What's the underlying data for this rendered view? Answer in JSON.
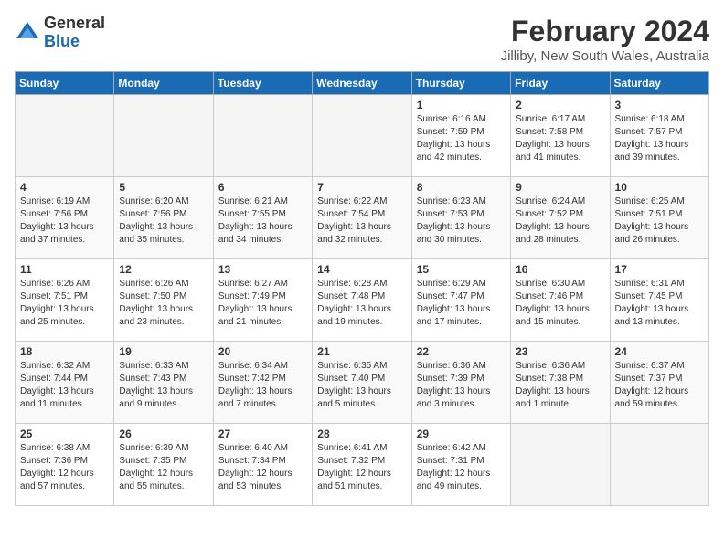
{
  "header": {
    "logo_general": "General",
    "logo_blue": "Blue",
    "month_title": "February 2024",
    "location": "Jilliby, New South Wales, Australia"
  },
  "days_of_week": [
    "Sunday",
    "Monday",
    "Tuesday",
    "Wednesday",
    "Thursday",
    "Friday",
    "Saturday"
  ],
  "weeks": [
    [
      {
        "day": "",
        "info": ""
      },
      {
        "day": "",
        "info": ""
      },
      {
        "day": "",
        "info": ""
      },
      {
        "day": "",
        "info": ""
      },
      {
        "day": "1",
        "info": "Sunrise: 6:16 AM\nSunset: 7:59 PM\nDaylight: 13 hours\nand 42 minutes."
      },
      {
        "day": "2",
        "info": "Sunrise: 6:17 AM\nSunset: 7:58 PM\nDaylight: 13 hours\nand 41 minutes."
      },
      {
        "day": "3",
        "info": "Sunrise: 6:18 AM\nSunset: 7:57 PM\nDaylight: 13 hours\nand 39 minutes."
      }
    ],
    [
      {
        "day": "4",
        "info": "Sunrise: 6:19 AM\nSunset: 7:56 PM\nDaylight: 13 hours\nand 37 minutes."
      },
      {
        "day": "5",
        "info": "Sunrise: 6:20 AM\nSunset: 7:56 PM\nDaylight: 13 hours\nand 35 minutes."
      },
      {
        "day": "6",
        "info": "Sunrise: 6:21 AM\nSunset: 7:55 PM\nDaylight: 13 hours\nand 34 minutes."
      },
      {
        "day": "7",
        "info": "Sunrise: 6:22 AM\nSunset: 7:54 PM\nDaylight: 13 hours\nand 32 minutes."
      },
      {
        "day": "8",
        "info": "Sunrise: 6:23 AM\nSunset: 7:53 PM\nDaylight: 13 hours\nand 30 minutes."
      },
      {
        "day": "9",
        "info": "Sunrise: 6:24 AM\nSunset: 7:52 PM\nDaylight: 13 hours\nand 28 minutes."
      },
      {
        "day": "10",
        "info": "Sunrise: 6:25 AM\nSunset: 7:51 PM\nDaylight: 13 hours\nand 26 minutes."
      }
    ],
    [
      {
        "day": "11",
        "info": "Sunrise: 6:26 AM\nSunset: 7:51 PM\nDaylight: 13 hours\nand 25 minutes."
      },
      {
        "day": "12",
        "info": "Sunrise: 6:26 AM\nSunset: 7:50 PM\nDaylight: 13 hours\nand 23 minutes."
      },
      {
        "day": "13",
        "info": "Sunrise: 6:27 AM\nSunset: 7:49 PM\nDaylight: 13 hours\nand 21 minutes."
      },
      {
        "day": "14",
        "info": "Sunrise: 6:28 AM\nSunset: 7:48 PM\nDaylight: 13 hours\nand 19 minutes."
      },
      {
        "day": "15",
        "info": "Sunrise: 6:29 AM\nSunset: 7:47 PM\nDaylight: 13 hours\nand 17 minutes."
      },
      {
        "day": "16",
        "info": "Sunrise: 6:30 AM\nSunset: 7:46 PM\nDaylight: 13 hours\nand 15 minutes."
      },
      {
        "day": "17",
        "info": "Sunrise: 6:31 AM\nSunset: 7:45 PM\nDaylight: 13 hours\nand 13 minutes."
      }
    ],
    [
      {
        "day": "18",
        "info": "Sunrise: 6:32 AM\nSunset: 7:44 PM\nDaylight: 13 hours\nand 11 minutes."
      },
      {
        "day": "19",
        "info": "Sunrise: 6:33 AM\nSunset: 7:43 PM\nDaylight: 13 hours\nand 9 minutes."
      },
      {
        "day": "20",
        "info": "Sunrise: 6:34 AM\nSunset: 7:42 PM\nDaylight: 13 hours\nand 7 minutes."
      },
      {
        "day": "21",
        "info": "Sunrise: 6:35 AM\nSunset: 7:40 PM\nDaylight: 13 hours\nand 5 minutes."
      },
      {
        "day": "22",
        "info": "Sunrise: 6:36 AM\nSunset: 7:39 PM\nDaylight: 13 hours\nand 3 minutes."
      },
      {
        "day": "23",
        "info": "Sunrise: 6:36 AM\nSunset: 7:38 PM\nDaylight: 13 hours\nand 1 minute."
      },
      {
        "day": "24",
        "info": "Sunrise: 6:37 AM\nSunset: 7:37 PM\nDaylight: 12 hours\nand 59 minutes."
      }
    ],
    [
      {
        "day": "25",
        "info": "Sunrise: 6:38 AM\nSunset: 7:36 PM\nDaylight: 12 hours\nand 57 minutes."
      },
      {
        "day": "26",
        "info": "Sunrise: 6:39 AM\nSunset: 7:35 PM\nDaylight: 12 hours\nand 55 minutes."
      },
      {
        "day": "27",
        "info": "Sunrise: 6:40 AM\nSunset: 7:34 PM\nDaylight: 12 hours\nand 53 minutes."
      },
      {
        "day": "28",
        "info": "Sunrise: 6:41 AM\nSunset: 7:32 PM\nDaylight: 12 hours\nand 51 minutes."
      },
      {
        "day": "29",
        "info": "Sunrise: 6:42 AM\nSunset: 7:31 PM\nDaylight: 12 hours\nand 49 minutes."
      },
      {
        "day": "",
        "info": ""
      },
      {
        "day": "",
        "info": ""
      }
    ]
  ]
}
